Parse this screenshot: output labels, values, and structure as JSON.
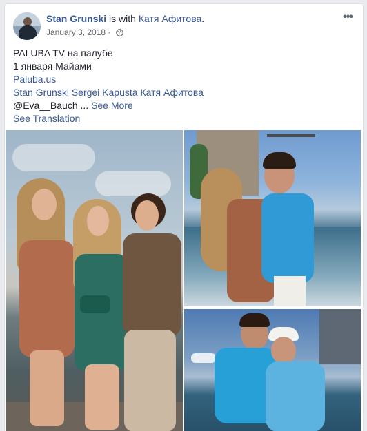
{
  "post": {
    "author": "Stan Grunski",
    "with_text": " is with ",
    "tagged": "Катя Афитова",
    "tagged_suffix": ".",
    "date": "January 3, 2018",
    "separator": " · ",
    "privacy_icon": "globe-icon",
    "more_icon": "ellipsis-icon",
    "more_label": "•••"
  },
  "text": {
    "line1": "PALUBA TV на палубе",
    "line2": "1 января Майами",
    "link_site": "Paluba.us",
    "tags_line": "Stan Grunski Sergei Kapusta Катя Афитова",
    "mention": "@Eva__Bauch ...",
    "see_more": "See More",
    "see_translation": "See Translation"
  },
  "photos": [
    {
      "name": "photo-three-women-dock"
    },
    {
      "name": "photo-couple-boat"
    },
    {
      "name": "photo-two-men-boat"
    }
  ],
  "colors": {
    "link": "#385898",
    "text": "#1d2129",
    "meta": "#616770",
    "background": "#e9ebee"
  }
}
